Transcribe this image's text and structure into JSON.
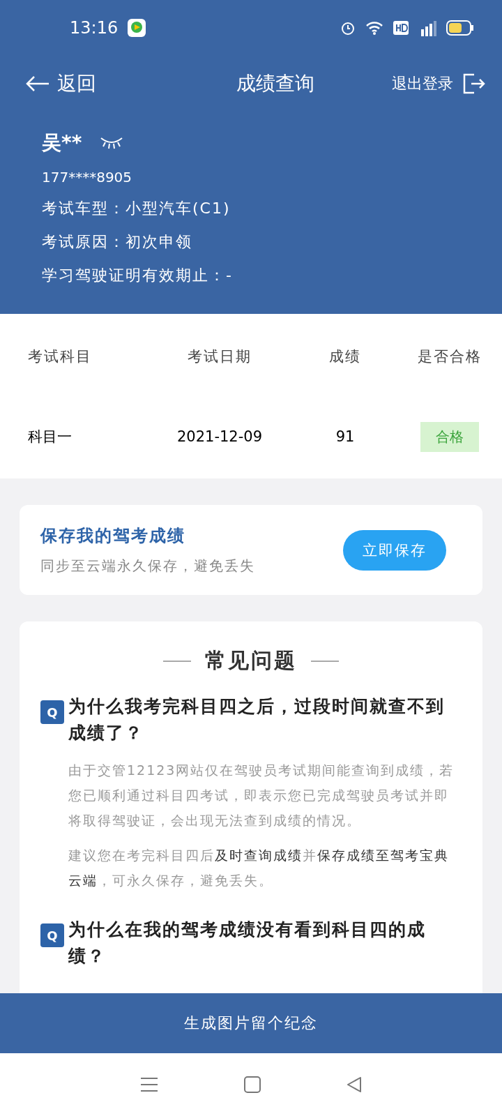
{
  "status_bar": {
    "time": "13:16"
  },
  "nav": {
    "back": "返回",
    "title": "成绩查询",
    "logout": "退出登录"
  },
  "user": {
    "name": "吴**",
    "phone": "177****8905",
    "info": [
      "考试车型：小型汽车(C1)",
      "考试原因：初次申领",
      "学习驾驶证明有效期止：-"
    ]
  },
  "table": {
    "columns": [
      "考试科目",
      "考试日期",
      "成绩",
      "是否合格"
    ],
    "rows": [
      {
        "subject": "科目一",
        "date": "2021-12-09",
        "score": "91",
        "result": "合格",
        "passed": true
      }
    ]
  },
  "save_card": {
    "title": "保存我的驾考成绩",
    "subtitle": "同步至云端永久保存，避免丢失",
    "button": "立即保存"
  },
  "faq": {
    "title": "常见问题",
    "items": [
      {
        "badge": "Q",
        "question": "为什么我考完科目四之后，过段时间就查不到成绩了？",
        "answers": [
          "由于交管12123网站仅在驾驶员考试期间能查询到成绩，若您已顺利通过科目四考试，即表示您已完成驾驶员考试并即将取得驾驶证，会出现无法查到成绩的情况。",
          "建议您在考完科目四后**及时查询成绩**并**保存成绩至驾考宝典云端**，可永久保存，避免丢失。"
        ]
      },
      {
        "badge": "Q",
        "question": "为什么在我的驾考成绩没有看到科目四的成绩？"
      }
    ]
  },
  "bottom_button": "生成图片留个纪念"
}
